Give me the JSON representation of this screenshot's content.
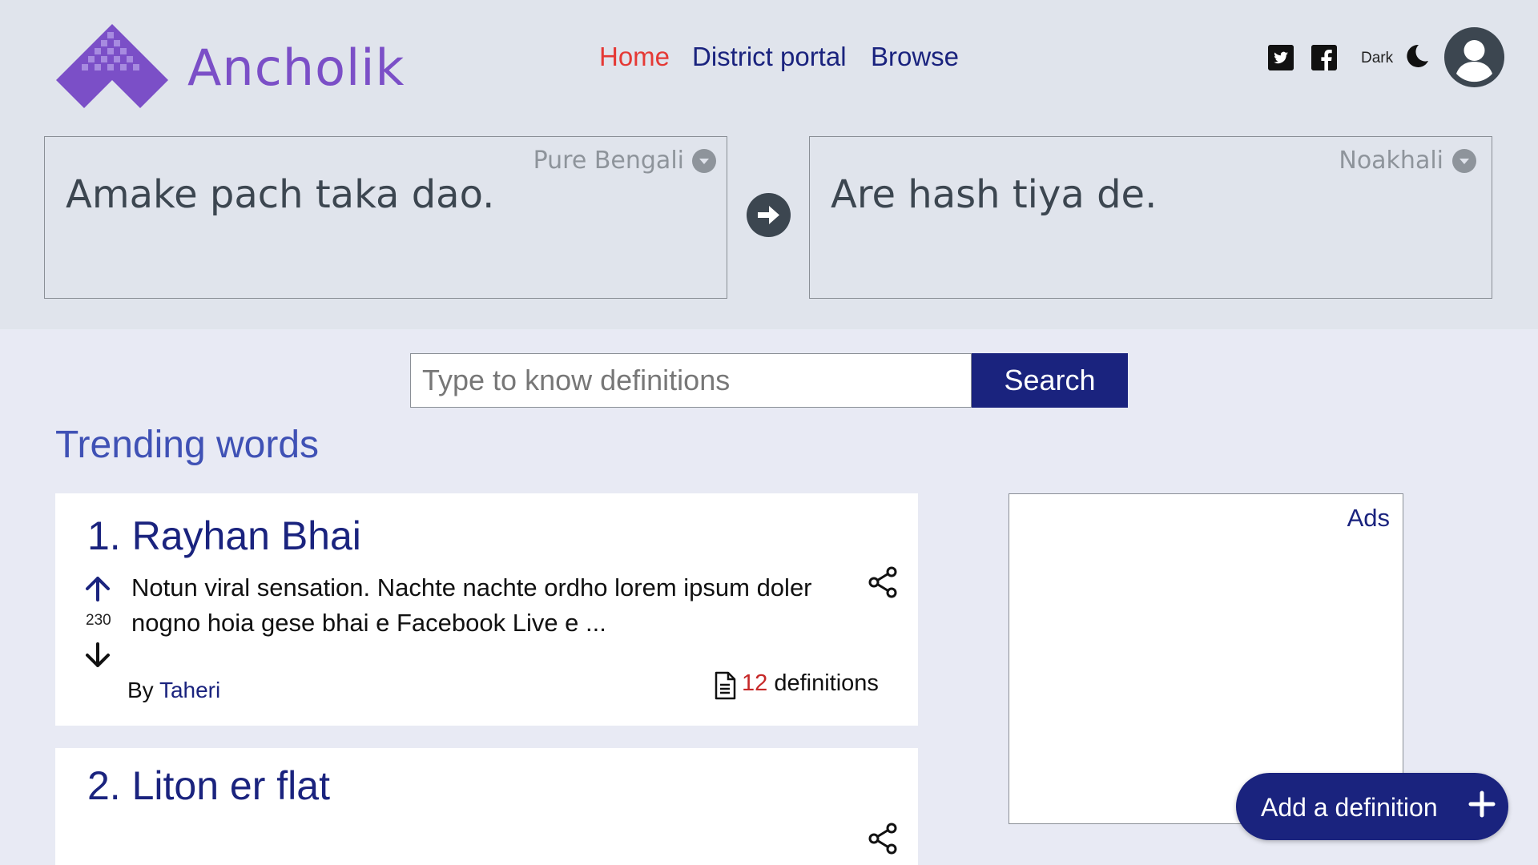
{
  "header": {
    "brand": "Ancholik",
    "nav": [
      {
        "label": "Home",
        "active": true
      },
      {
        "label": "District portal",
        "active": false
      },
      {
        "label": "Browse",
        "active": false
      }
    ],
    "theme_toggle_label": "Dark",
    "icons": [
      "twitter-icon",
      "facebook-icon",
      "moon-icon",
      "user-avatar-icon"
    ]
  },
  "translator": {
    "source": {
      "language": "Pure Bengali",
      "text": "Amake pach taka dao."
    },
    "target": {
      "language": "Noakhali",
      "text": "Are hash tiya de."
    }
  },
  "search": {
    "placeholder": "Type to know definitions",
    "value": "",
    "button_label": "Search"
  },
  "trending": {
    "title": "Trending words",
    "items": [
      {
        "rank_title": "1. Rayhan Bhai",
        "votes": "230",
        "description": "Notun viral sensation. Nachte nachte ordho lorem ipsum doler nogno hoia gese bhai e Facebook Live e ...",
        "by_label": "By",
        "author": "Taheri",
        "definitions_count": "12",
        "definitions_label": "definitions"
      },
      {
        "rank_title": "2. Liton er flat"
      }
    ]
  },
  "ads": {
    "label": "Ads"
  },
  "fab": {
    "label": "Add a definition"
  },
  "colors": {
    "primary": "#1a237e",
    "active_nav": "#e53935",
    "brand": "#7b4fc7",
    "accent_blue": "#3f51b5",
    "header_bg": "#e0e4ec",
    "page_bg": "#e8eaf4"
  }
}
